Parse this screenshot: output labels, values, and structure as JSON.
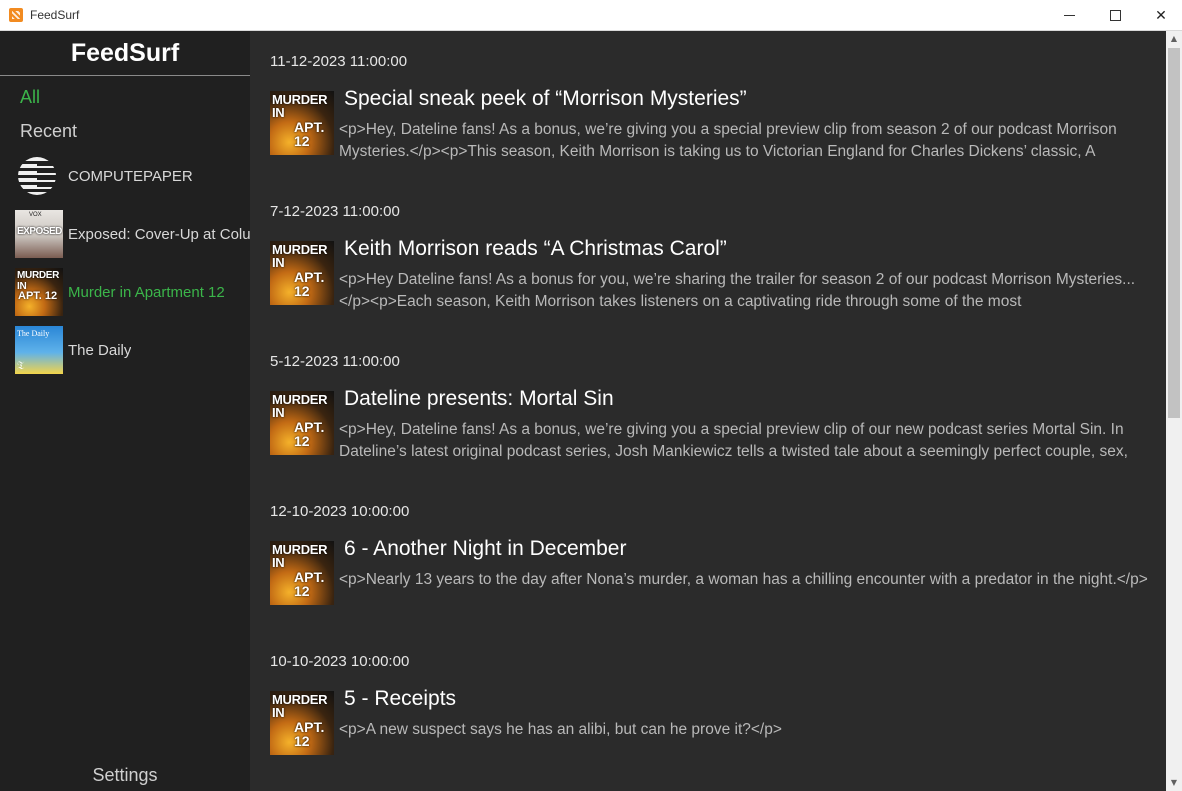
{
  "window": {
    "title": "FeedSurf",
    "icon": "rss-app-icon",
    "controls": {
      "minimize": "minimize-icon",
      "maximize": "maximize-icon",
      "close": "✕"
    }
  },
  "sidebar": {
    "brand": "FeedSurf",
    "nav": {
      "all": "All",
      "recent": "Recent"
    },
    "feeds": [
      {
        "label": "COMPUTEPAPER",
        "active": false
      },
      {
        "label": "Exposed: Cover-Up at Columbia",
        "active": false,
        "thumb_title": "EXPOSED",
        "thumb_top": "VOX"
      },
      {
        "label": "Murder in Apartment 12",
        "active": true,
        "thumb_title": "MURDER IN",
        "thumb_sub": "APT. 12"
      },
      {
        "label": "The Daily",
        "active": false,
        "thumb_title": "The Daily",
        "thumb_logo": "𝔗"
      }
    ],
    "settings": "Settings"
  },
  "colors": {
    "accent_green": "#3bb54a",
    "sidebar_bg": "#202020",
    "main_bg": "#2b2b2b"
  },
  "episodes": [
    {
      "date": "11-12-2023 11:00:00",
      "title": "Special sneak peek of “Morrison Mysteries”",
      "description": "<p>Hey, Dateline fans! As a bonus, we’re giving you a special preview clip from season 2 of our podcast Morrison Mysteries.</p><p>This season, Keith Morrison is taking us to Victorian England for Charles Dickens’ classic, A",
      "thumb_title": "MURDER IN",
      "thumb_sub": "APT. 12"
    },
    {
      "date": "7-12-2023 11:00:00",
      "title": "Keith Morrison reads “A Christmas Carol”",
      "description": "<p>Hey Dateline fans! As a bonus for you, we’re sharing the trailer for season 2 of our podcast Morrison Mysteries...</p><p>Each season, Keith Morrison takes listeners on a captivating ride through some of the most",
      "thumb_title": "MURDER IN",
      "thumb_sub": "APT. 12"
    },
    {
      "date": "5-12-2023 11:00:00",
      "title": "Dateline presents: Mortal Sin",
      "description": "<p>Hey, Dateline fans! As a bonus, we’re giving you a special preview clip of our new podcast series Mortal Sin. In Dateline’s latest original podcast series, Josh Mankiewicz tells a twisted tale about a seemingly perfect couple, sex,",
      "thumb_title": "MURDER IN",
      "thumb_sub": "APT. 12"
    },
    {
      "date": "12-10-2023 10:00:00",
      "title": "6 - Another Night in December",
      "description": "<p>Nearly 13 years to the day after Nona’s murder, a woman has a chilling encounter with a predator in the night.</p>",
      "thumb_title": "MURDER IN",
      "thumb_sub": "APT. 12"
    },
    {
      "date": "10-10-2023 10:00:00",
      "title": "5 - Receipts",
      "description": "<p>A new suspect says he has an alibi, but can he prove it?</p>",
      "thumb_title": "MURDER IN",
      "thumb_sub": "APT. 12"
    }
  ],
  "scrollbar": {
    "up": "▲",
    "down": "▼"
  }
}
